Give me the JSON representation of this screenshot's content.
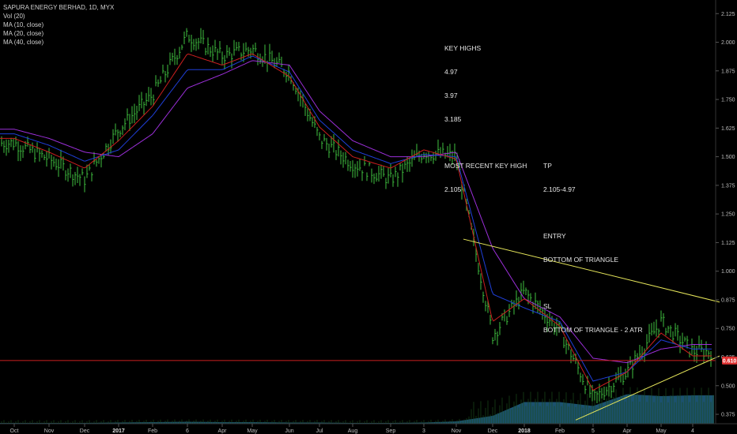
{
  "legend": {
    "symbol_line": "SAPURA ENERGY BERHAD, 1D, MYX",
    "vol_line": "Vol (20)",
    "ma10_line": "MA (10, close)",
    "ma20_line": "MA (20, close)",
    "ma40_line": "MA (40, close)"
  },
  "notes": {
    "key_highs_title": "KEY HIGHS",
    "key_highs_1": "4.97",
    "key_highs_2": "3.97",
    "key_highs_3": "3.185",
    "recent_title": "MOST RECENT KEY HIGH",
    "recent_value": "2.105",
    "tp_title": "TP",
    "tp_value": "2.105-4.97",
    "entry_title": "ENTRY",
    "entry_value": "BOTTOM OF TRIANGLE",
    "sl_title": "SL",
    "sl_value": "BOTTOM OF TRIANGLE - 2 ATR"
  },
  "chart_data": {
    "type": "line",
    "title": "SAPURA ENERGY BERHAD, 1D, MYX",
    "y_ticks": [
      "2.125",
      "2.000",
      "1.875",
      "1.750",
      "1.625",
      "1.500",
      "1.375",
      "1.250",
      "1.125",
      "1.000",
      "0.875",
      "0.750",
      "0.625",
      "0.500",
      "0.375"
    ],
    "ylim": [
      0.32,
      2.15
    ],
    "x_ticks": [
      "Oct",
      "Nov",
      "Dec",
      "2017",
      "Feb",
      "6",
      "Apr",
      "May",
      "Jun",
      "Jul",
      "Aug",
      "Sep",
      "3",
      "Nov",
      "Dec",
      "2018",
      "Feb",
      "5",
      "Apr",
      "May",
      "4"
    ],
    "bold_x_ticks": [
      "2017",
      "2018"
    ],
    "last_price": "0.610",
    "last_price_value": 0.61,
    "horizontal_line": 0.61,
    "trendlines": [
      {
        "name": "upper",
        "from": [
          "Sep",
          1.14
        ],
        "to": [
          "end",
          0.865
        ]
      },
      {
        "name": "lower",
        "from": [
          "5",
          0.35
        ],
        "to": [
          "end",
          0.63
        ]
      }
    ],
    "series": [
      {
        "name": "close",
        "x": [
          "Oct",
          "Nov",
          "Dec",
          "2017",
          "Feb",
          "6",
          "Apr",
          "May",
          "Jun",
          "Jul",
          "Aug",
          "Sep",
          "3",
          "Nov",
          "Dec",
          "2018",
          "Feb",
          "5",
          "Apr",
          "May",
          "4"
        ],
        "values": [
          1.56,
          1.49,
          1.4,
          1.62,
          1.77,
          2.03,
          1.94,
          1.97,
          1.87,
          1.58,
          1.47,
          1.4,
          1.52,
          1.5,
          0.72,
          0.91,
          0.74,
          0.44,
          0.56,
          0.78,
          0.65
        ]
      },
      {
        "name": "MA (10, close)",
        "x": [
          "Oct",
          "Nov",
          "Dec",
          "2017",
          "Feb",
          "6",
          "Apr",
          "May",
          "Jun",
          "Jul",
          "Aug",
          "Sep",
          "3",
          "Nov",
          "Dec",
          "2018",
          "Feb",
          "5",
          "Apr",
          "May",
          "4"
        ],
        "values": [
          1.58,
          1.52,
          1.45,
          1.57,
          1.72,
          1.95,
          1.9,
          1.95,
          1.85,
          1.63,
          1.5,
          1.45,
          1.53,
          1.49,
          0.78,
          0.88,
          0.76,
          0.48,
          0.56,
          0.73,
          0.63
        ]
      },
      {
        "name": "MA (20, close)",
        "x": [
          "Oct",
          "Nov",
          "Dec",
          "2017",
          "Feb",
          "6",
          "Apr",
          "May",
          "Jun",
          "Jul",
          "Aug",
          "Sep",
          "3",
          "Nov",
          "Dec",
          "2018",
          "Feb",
          "5",
          "Apr",
          "May",
          "4"
        ],
        "values": [
          1.6,
          1.55,
          1.48,
          1.53,
          1.68,
          1.88,
          1.88,
          1.94,
          1.87,
          1.66,
          1.53,
          1.47,
          1.51,
          1.5,
          0.9,
          0.84,
          0.78,
          0.52,
          0.56,
          0.7,
          0.66
        ]
      },
      {
        "name": "MA (40, close)",
        "x": [
          "Oct",
          "Nov",
          "Dec",
          "2017",
          "Feb",
          "6",
          "Apr",
          "May",
          "Jun",
          "Jul",
          "Aug",
          "Sep",
          "3",
          "Nov",
          "Dec",
          "2018",
          "Feb",
          "5",
          "Apr",
          "May",
          "4"
        ],
        "values": [
          1.62,
          1.58,
          1.52,
          1.5,
          1.6,
          1.8,
          1.86,
          1.92,
          1.9,
          1.7,
          1.57,
          1.5,
          1.5,
          1.52,
          1.1,
          0.88,
          0.8,
          0.62,
          0.6,
          0.66,
          0.68
        ]
      },
      {
        "name": "Vol (20)",
        "x": [
          "Oct",
          "Nov",
          "Dec",
          "2017",
          "Feb",
          "6",
          "Apr",
          "May",
          "Jun",
          "Jul",
          "Aug",
          "Sep",
          "3",
          "Nov",
          "Dec",
          "2018",
          "Feb",
          "5",
          "Apr",
          "May",
          "4"
        ],
        "values": [
          0.02,
          0.02,
          0.02,
          0.03,
          0.04,
          0.05,
          0.04,
          0.04,
          0.03,
          0.03,
          0.02,
          0.02,
          0.03,
          0.06,
          0.2,
          0.55,
          0.55,
          0.45,
          0.75,
          0.7,
          0.72
        ]
      }
    ],
    "colors": {
      "background": "#000000",
      "bars": "#3fbf3f",
      "ma10": "#cc1f1f",
      "ma20": "#1f3fd9",
      "ma40": "#9b2fd9",
      "volume": "#1e5a7a",
      "trendline": "#e6e65a",
      "hline": "#cc1f1f",
      "price_tag": "#e03131"
    }
  }
}
